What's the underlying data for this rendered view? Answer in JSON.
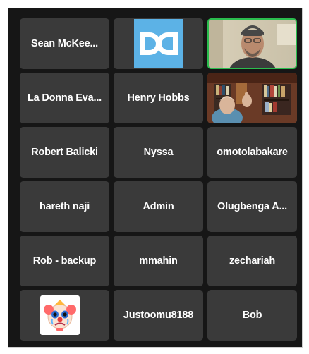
{
  "participants": [
    {
      "name": "Sean McKee..."
    },
    {
      "name": "",
      "avatar": "dd-logo-icon"
    },
    {
      "name": "",
      "video": "webcam-man-beanie",
      "active": true
    },
    {
      "name": "La Donna Eva..."
    },
    {
      "name": "Henry Hobbs"
    },
    {
      "name": "",
      "video": "webcam-man-bookshelf"
    },
    {
      "name": "Robert Balicki"
    },
    {
      "name": "Nyssa"
    },
    {
      "name": "omotolabakare"
    },
    {
      "name": "hareth naji"
    },
    {
      "name": "Admin"
    },
    {
      "name": "Olugbenga A..."
    },
    {
      "name": "Rob - backup"
    },
    {
      "name": "mmahin"
    },
    {
      "name": "zechariah"
    },
    {
      "name": "",
      "avatar": "crying-clown-emoji-icon"
    },
    {
      "name": "Justoomu8188"
    },
    {
      "name": "Bob"
    }
  ],
  "colors": {
    "background": "#161616",
    "tile": "#3a3a3a",
    "active_speaker_border": "#2bbd4e",
    "logo_blue": "#5cb2e6",
    "name_text": "#ffffff"
  }
}
